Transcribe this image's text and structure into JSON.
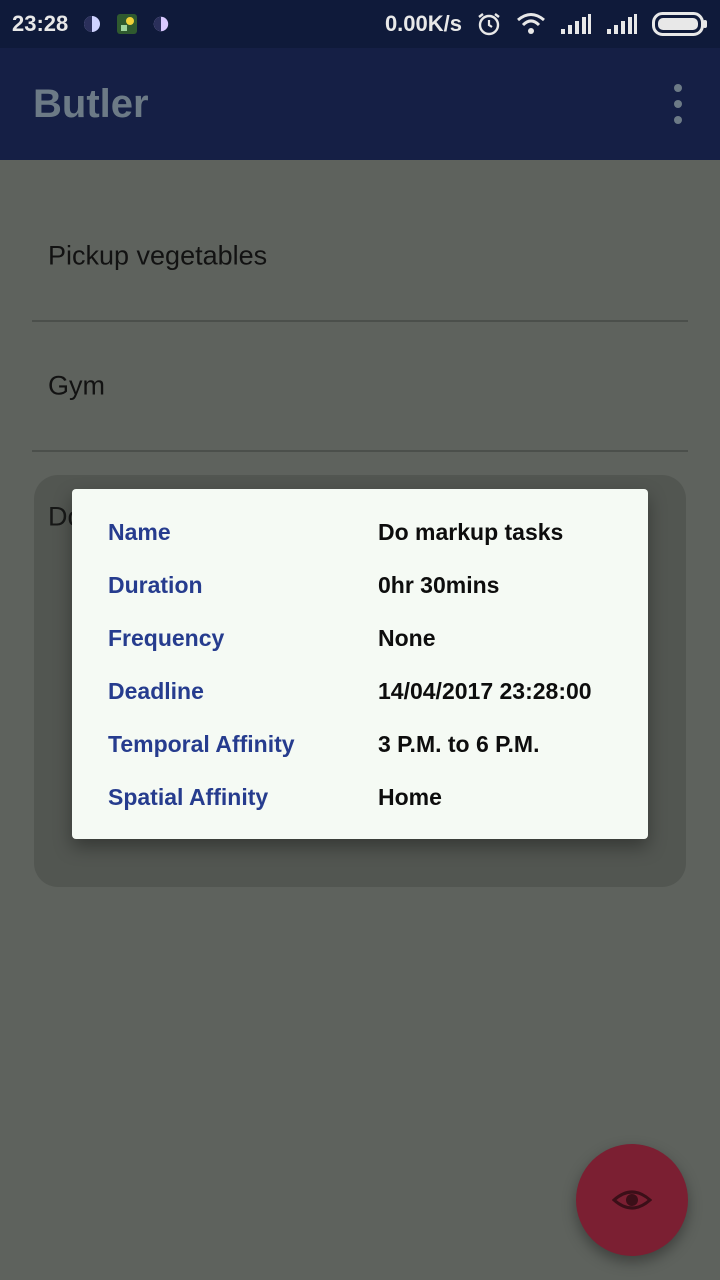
{
  "status_bar": {
    "time": "23:28",
    "net_speed": "0.00K/s",
    "icons": [
      "moon-app-icon",
      "notification-app-icon",
      "moon-app-icon-2",
      "alarm-icon",
      "wifi-icon",
      "signal-icon",
      "signal-icon-2",
      "battery-icon"
    ]
  },
  "app_bar": {
    "title": "Butler",
    "menu_icon": "more-vert-icon"
  },
  "tasks": [
    {
      "label": "Pickup vegetables"
    },
    {
      "label": "Gym"
    },
    {
      "label": "Do"
    }
  ],
  "dialog": {
    "rows": [
      {
        "label": "Name",
        "value": "Do markup tasks"
      },
      {
        "label": "Duration",
        "value": "0hr 30mins"
      },
      {
        "label": "Frequency",
        "value": "None"
      },
      {
        "label": "Deadline",
        "value": "14/04/2017 23:28:00"
      },
      {
        "label": "Temporal Affinity",
        "value": "3 P.M. to 6 P.M."
      },
      {
        "label": "Spatial Affinity",
        "value": "Home"
      }
    ]
  },
  "fab": {
    "icon": "eye-icon"
  },
  "colors": {
    "status_bar_bg": "#0f1a3a",
    "app_bar_bg": "#151f45",
    "scrim_bg": "#5e625d",
    "dialog_label": "#263c8e",
    "fab_bg": "#7b1f32"
  }
}
